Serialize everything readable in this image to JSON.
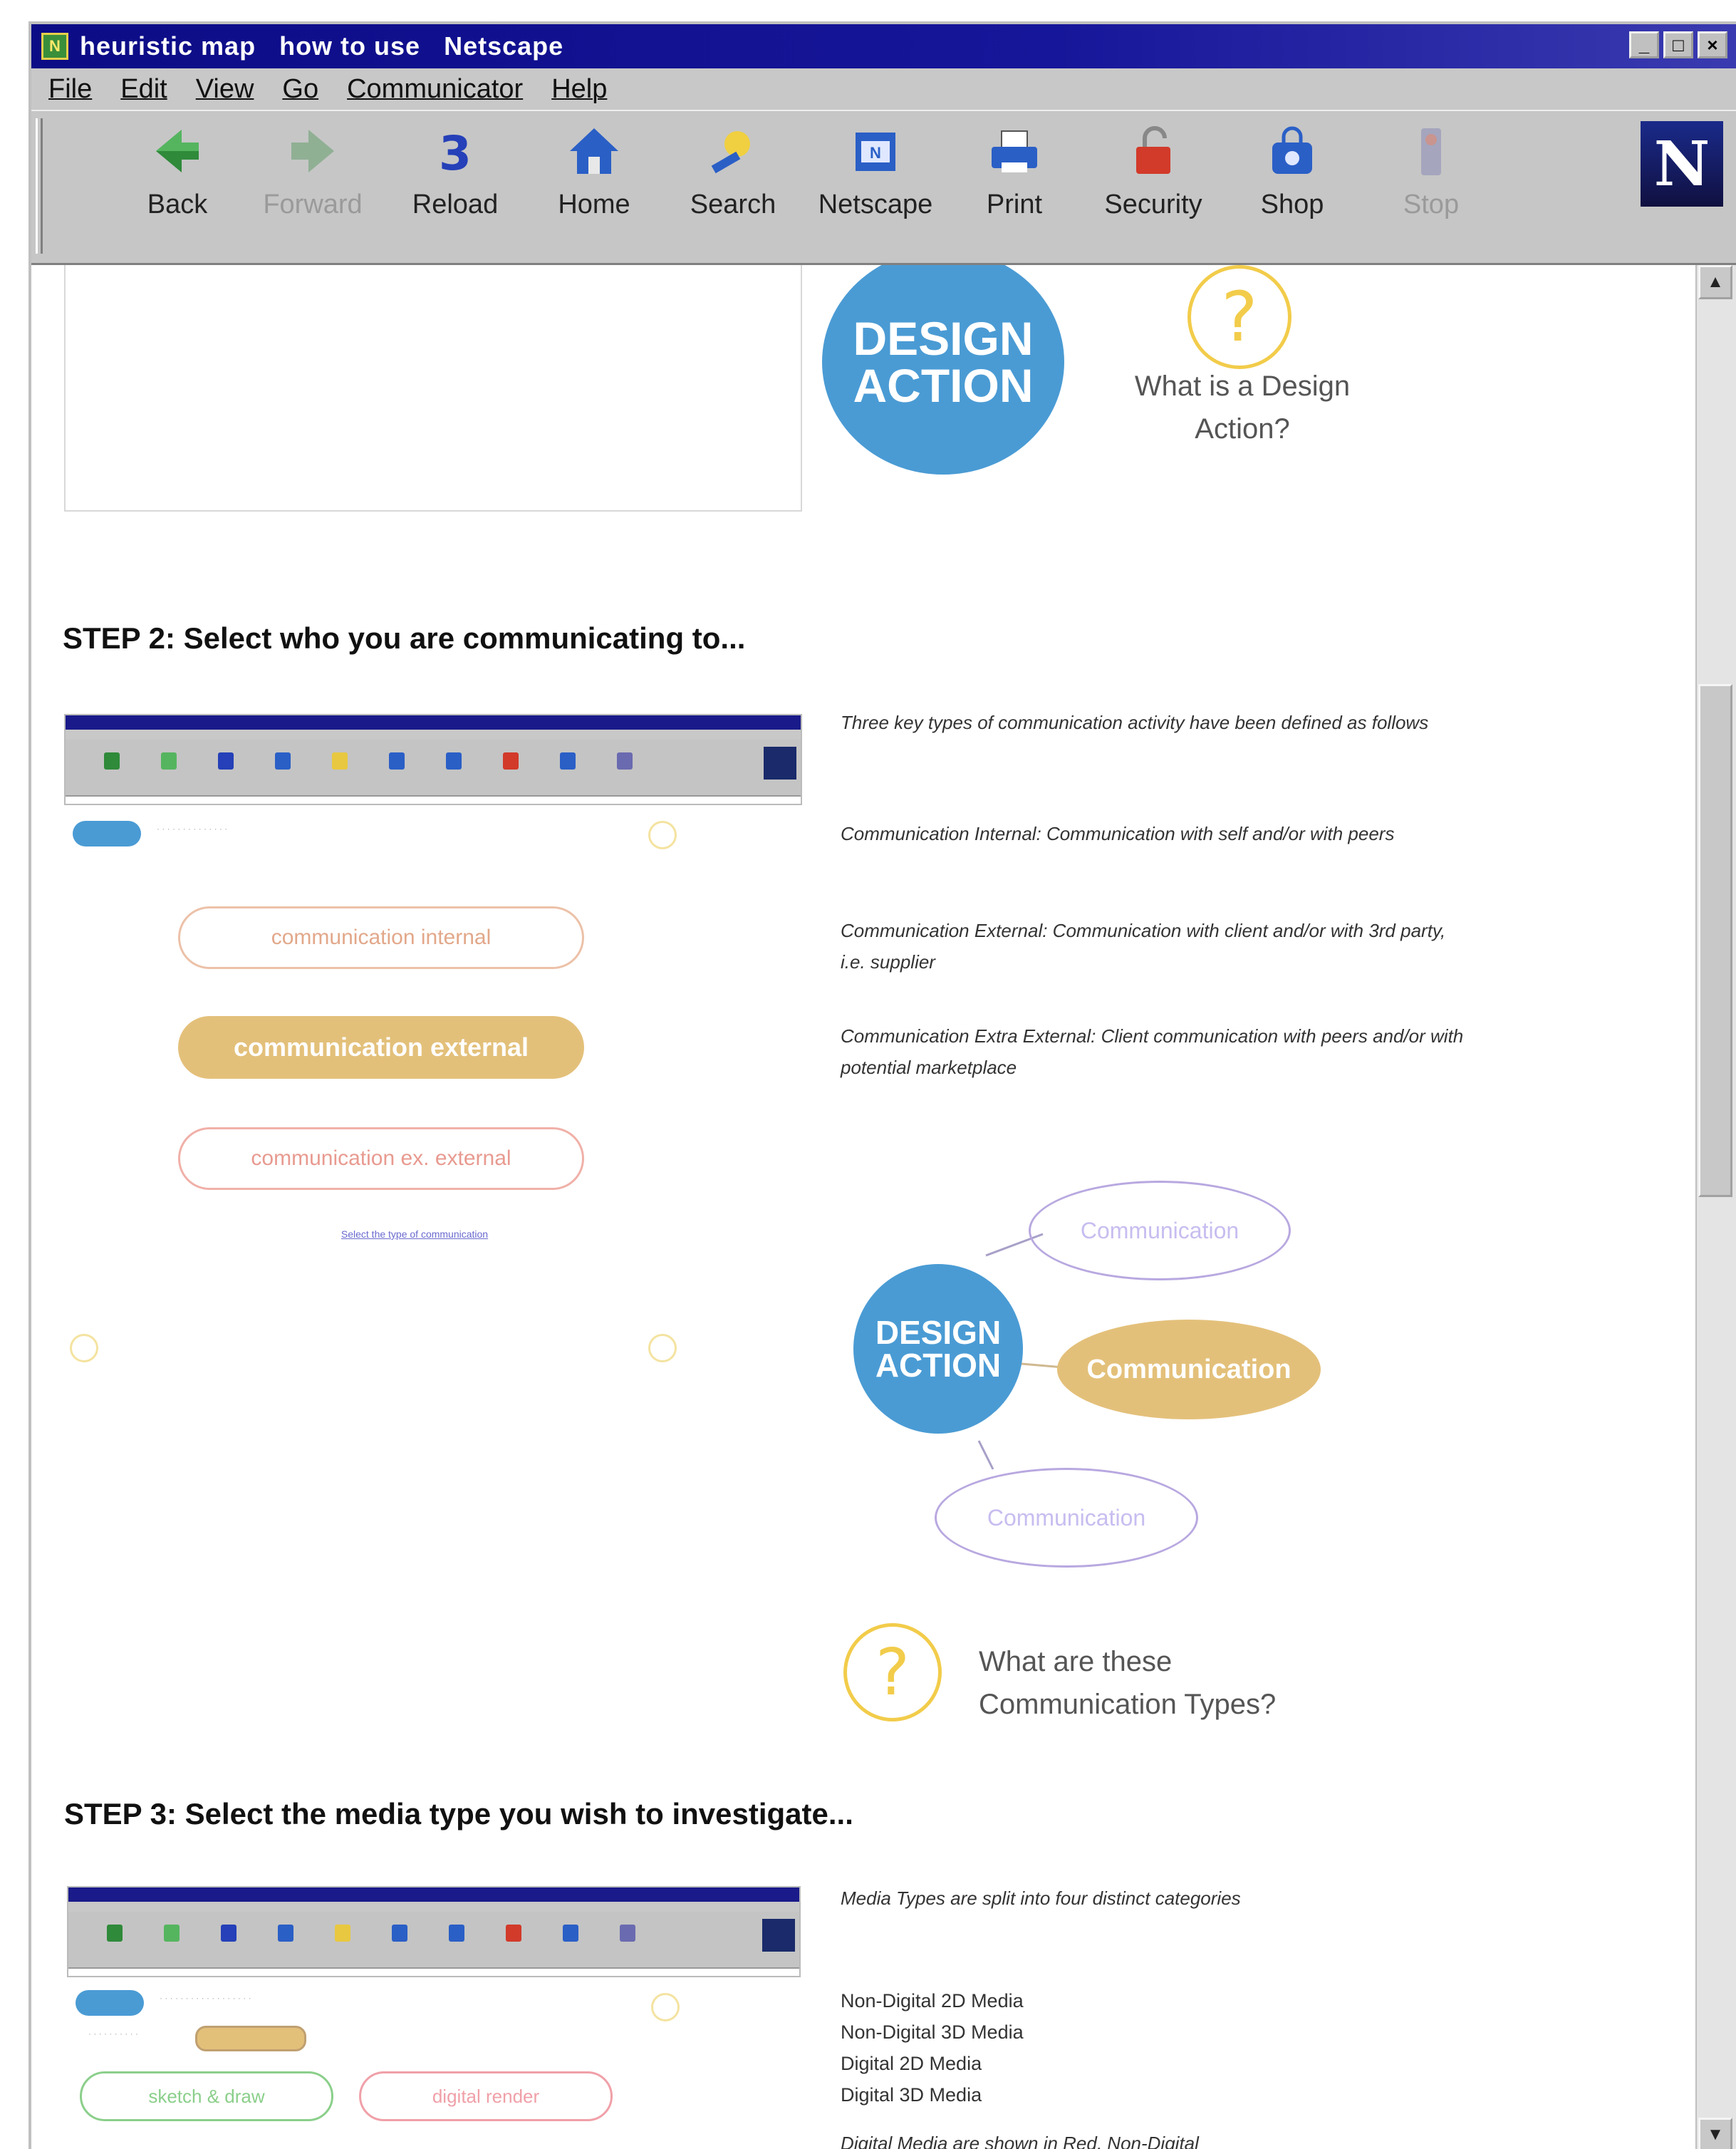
{
  "window": {
    "title": "heuristic map   how to use   Netscape",
    "buttons": [
      "_",
      "□",
      "×"
    ]
  },
  "menu": [
    "File",
    "Edit",
    "View",
    "Go",
    "Communicator",
    "Help"
  ],
  "toolbar": {
    "items": [
      {
        "label": "Back",
        "icon": "back-arrow-icon",
        "enabled": true
      },
      {
        "label": "Forward",
        "icon": "forward-arrow-icon",
        "enabled": false
      },
      {
        "label": "Reload",
        "icon": "reload-icon",
        "enabled": true
      },
      {
        "label": "Home",
        "icon": "home-icon",
        "enabled": true
      },
      {
        "label": "Search",
        "icon": "search-icon",
        "enabled": true
      },
      {
        "label": "Netscape",
        "icon": "netscape-icon",
        "enabled": true
      },
      {
        "label": "Print",
        "icon": "print-icon",
        "enabled": true
      },
      {
        "label": "Security",
        "icon": "security-icon",
        "enabled": true
      },
      {
        "label": "Shop",
        "icon": "shop-icon",
        "enabled": true
      },
      {
        "label": "Stop",
        "icon": "stop-icon",
        "enabled": false
      }
    ],
    "logo": "N"
  },
  "step1": {
    "design_action_line1": "DESIGN",
    "design_action_line2": "ACTION",
    "question": "What is a Design Action?",
    "qmark": "?"
  },
  "step2": {
    "heading": "STEP 2: Select who you are communicating to...",
    "intro": "Three key types of communication activity have been defined as follows",
    "definitions": [
      "Communication Internal:  Communication with self and/or with peers",
      "Communication External:  Communication with client and/or with 3rd party, i.e. supplier",
      "Communication Extra External:  Client communication with peers and/or with potential marketplace"
    ],
    "mini_pills": [
      "communication internal",
      "communication external",
      "communication ex. external"
    ],
    "mini_link": "Select the type of communication",
    "diagram": {
      "center_line1": "DESIGN",
      "center_line2": "ACTION",
      "nodes": [
        "Communication",
        "Communication",
        "Communication"
      ]
    },
    "question_line1": "What are these",
    "question_line2": "Communication Types?",
    "qmark": "?"
  },
  "step3": {
    "heading": "STEP 3: Select the media type you wish to investigate...",
    "intro": "Media Types are split into four distinct categories",
    "media_types": [
      "Non-Digital 2D Media",
      "Non-Digital 3D Media",
      "Digital 2D Media",
      "Digital 3D Media"
    ],
    "footnote": "Digital Media are shown in Red, Non-Digital",
    "mini_pills": [
      "sketch & draw",
      "digital render"
    ]
  },
  "colors": {
    "design_action_blue": "#4a9bd4",
    "question_yellow": "#f2cc4a",
    "communication_gold": "#e3c07a",
    "communication_purple": "#b8a8e0",
    "internal_orange": "#ecc1a8",
    "nondigital_green": "#8bcf8b",
    "digital_red": "#f0a0a8"
  }
}
